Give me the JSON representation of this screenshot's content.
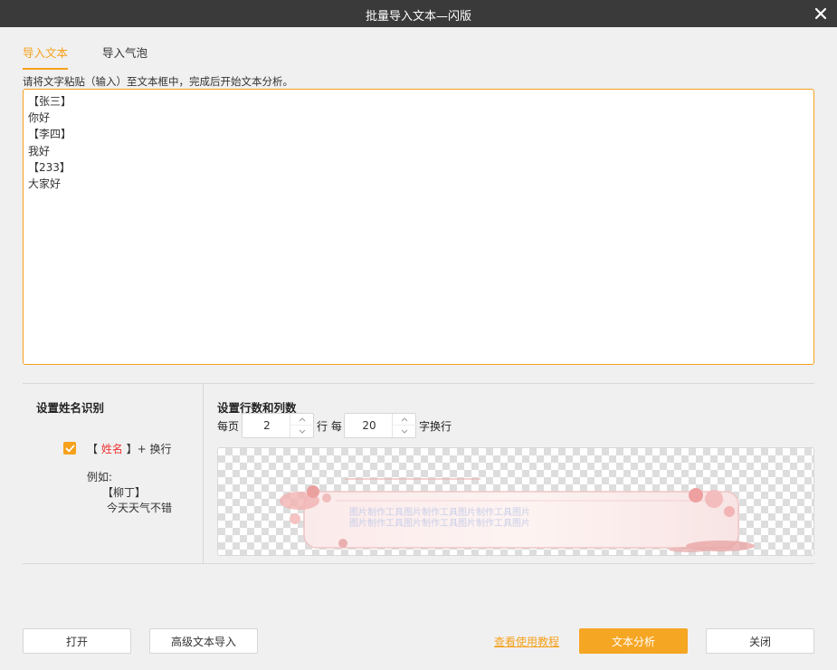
{
  "window": {
    "title": "批量导入文本—闪版"
  },
  "tabs": [
    {
      "label": "导入文本",
      "active": true
    },
    {
      "label": "导入气泡",
      "active": false
    }
  ],
  "hint": "请将文字粘贴（输入）至文本框中，完成后开始文本分析。",
  "textarea": {
    "lines": [
      "【张三】",
      "你好",
      "【李四】",
      "我好",
      "【233】",
      "大家好"
    ]
  },
  "name_recognition": {
    "title": "设置姓名识别",
    "checked": true,
    "rule_open": "【 ",
    "rule_name": "姓名",
    "rule_close": " 】+ 换行",
    "example_label": "例如:",
    "example_name": "【柳丁】",
    "example_text": "今天天气不错"
  },
  "rows_cols": {
    "title": "设置行数和列数",
    "per_page_label": "每页",
    "rows_value": "2",
    "rows_suffix": "行 每",
    "cols_value": "20",
    "cols_suffix": "字换行"
  },
  "preview": {
    "line1": "图片制作工具图片制作工具图片制作工具图片",
    "line2": "图片制作工具图片制作工具图片制作工具图片"
  },
  "footer": {
    "open": "打开",
    "advanced_import": "高级文本导入",
    "tutorial_link": "查看使用教程",
    "analyze": "文本分析",
    "close": "关闭"
  },
  "colors": {
    "accent": "#f5a11c",
    "titlebar": "#3a3a3a",
    "highlight": "#e33333"
  },
  "icons": [
    "close-icon",
    "check-icon",
    "chevron-up-icon",
    "chevron-down-icon"
  ]
}
